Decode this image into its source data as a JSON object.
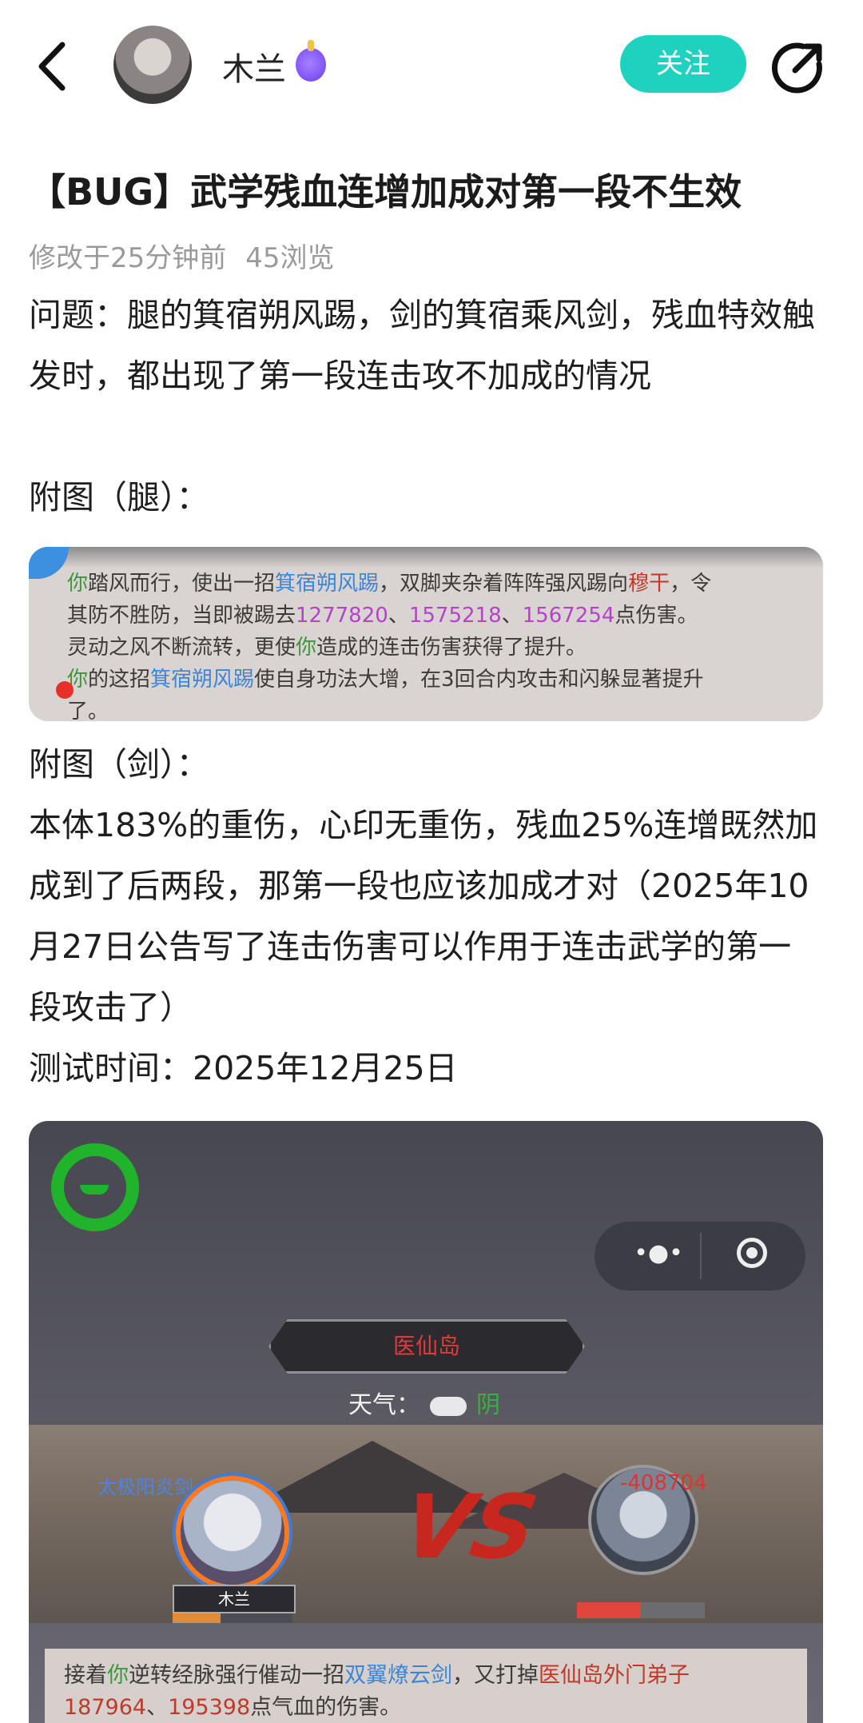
{
  "header": {
    "author_name": "木兰",
    "follow_label": "关注"
  },
  "post": {
    "title": "【BUG】武学残血连增加成对第一段不生效",
    "modified": "修改于25分钟前",
    "views": "45浏览",
    "paragraphs": [
      "问题：腿的箕宿朔风踢，剑的箕宿乘风剑，残血特效触发时，都出现了第一段连击攻不加成的情况",
      "附图（腿）：",
      "附图（剑）：",
      "本体183%的重伤，心印无重伤，残血25%连增既然加成到了后两段，那第一段也应该加成才对（2025年10月27日公告写了连击伤害可以作用于连击武学的第一段攻击了）",
      "测试时间：2025年12月25日"
    ]
  },
  "image1": {
    "line1_a": "你",
    "line1_b": "踏风而行，使出一招",
    "line1_skill": "箕宿朔风踢",
    "line1_c": "，双脚夹杂着阵阵强风踢向",
    "line1_target": "穆干",
    "line1_d": "，令",
    "line2_a": "其防不胜防，当即被踢去",
    "dmg1": "1277820",
    "sep1": "、",
    "dmg2": "1575218",
    "sep2": "、",
    "dmg3": "1567254",
    "line2_b": "点伤害。",
    "line3_a": "灵动之风不断流转，更使",
    "line3_you": "你",
    "line3_b": "造成的连击伤害获得了提升。",
    "line4_a": "你",
    "line4_b": "的这招",
    "line4_skill": "箕宿朔风踢",
    "line4_c": "使自身功法大增，在3回合内攻击和闪躲显著提升",
    "line5": "了。"
  },
  "image2": {
    "location": "医仙岛",
    "weather_label": "天气：",
    "weather_value": "阴",
    "vs": "VS",
    "player_name": "木兰",
    "player_skill_label": "太极阳炎剑",
    "opponent_damage": "-408704",
    "menu_dots": "•●•",
    "log_a": "接着",
    "log_you": "你",
    "log_b": "逆转经脉强行催动一招",
    "log_skill": "双翼燎云剑",
    "log_c": "，又打掉",
    "log_target": "医仙岛外门弟子",
    "log_dmg1": "187964",
    "log_sep": "、",
    "log_dmg2": "195398",
    "log_d": "点气血的伤害。"
  },
  "colors": {
    "accent": "#1fd2bf",
    "meta_text": "#9a9a9a"
  }
}
